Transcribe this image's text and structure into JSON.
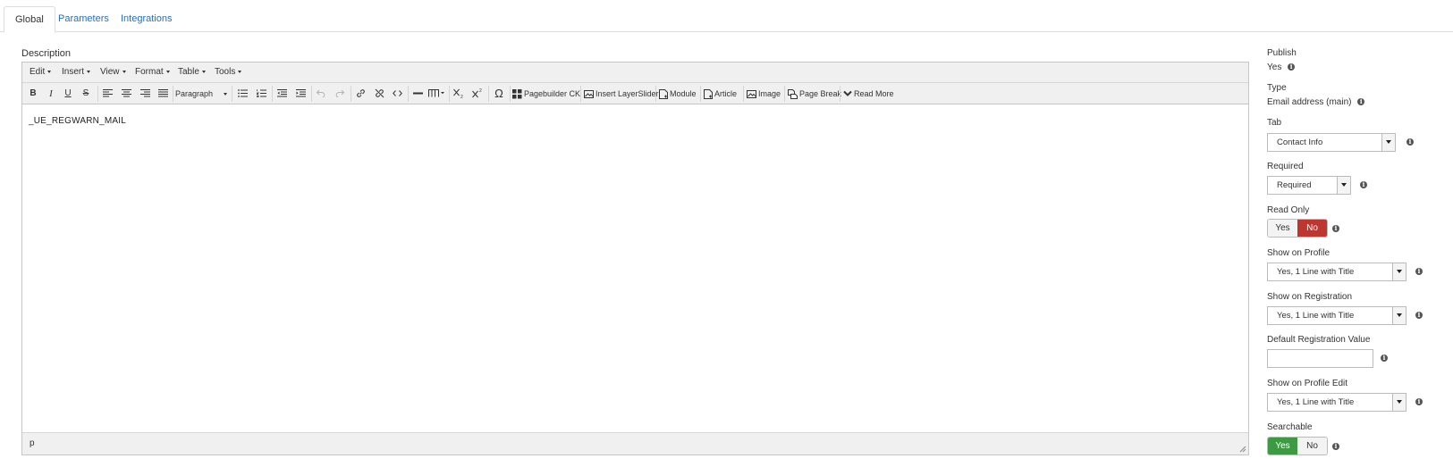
{
  "tabs": [
    {
      "label": "Global",
      "active": true
    },
    {
      "label": "Parameters",
      "active": false
    },
    {
      "label": "Integrations",
      "active": false
    }
  ],
  "description": {
    "label": "Description",
    "menu": [
      "Edit",
      "Insert",
      "View",
      "Format",
      "Table",
      "Tools"
    ],
    "toolbar": {
      "bold": "B",
      "italic": "I",
      "underline": "U",
      "strike": "S",
      "format_select": "Paragraph",
      "special_char": "Ω",
      "pagebuilder": "Pagebuilder CK",
      "insert_layerslider": "Insert LayerSlider",
      "module": "Module",
      "article": "Article",
      "image": "Image",
      "page_break": "Page Break",
      "read_more": "Read More"
    },
    "content": "_UE_REGWARN_MAIL",
    "path": "p"
  },
  "panel": {
    "publish": {
      "label": "Publish",
      "value": "Yes"
    },
    "type": {
      "label": "Type",
      "value": "Email address (main)"
    },
    "tab": {
      "label": "Tab",
      "value": "Contact Info"
    },
    "required": {
      "label": "Required",
      "value": "Required"
    },
    "read_only": {
      "label": "Read Only",
      "yes": "Yes",
      "no": "No",
      "selected": "No"
    },
    "show_on_profile": {
      "label": "Show on Profile",
      "value": "Yes, 1 Line with Title"
    },
    "show_on_registration": {
      "label": "Show on Registration",
      "value": "Yes, 1 Line with Title"
    },
    "default_registration_value": {
      "label": "Default Registration Value",
      "value": ""
    },
    "show_on_profile_edit": {
      "label": "Show on Profile Edit",
      "value": "Yes, 1 Line with Title"
    },
    "searchable": {
      "label": "Searchable",
      "yes": "Yes",
      "no": "No",
      "selected": "Yes"
    },
    "info_glyph": "i"
  },
  "colors": {
    "link": "#2a6ebb",
    "no_active": "#bd362f",
    "yes_active": "#3d9a42"
  }
}
